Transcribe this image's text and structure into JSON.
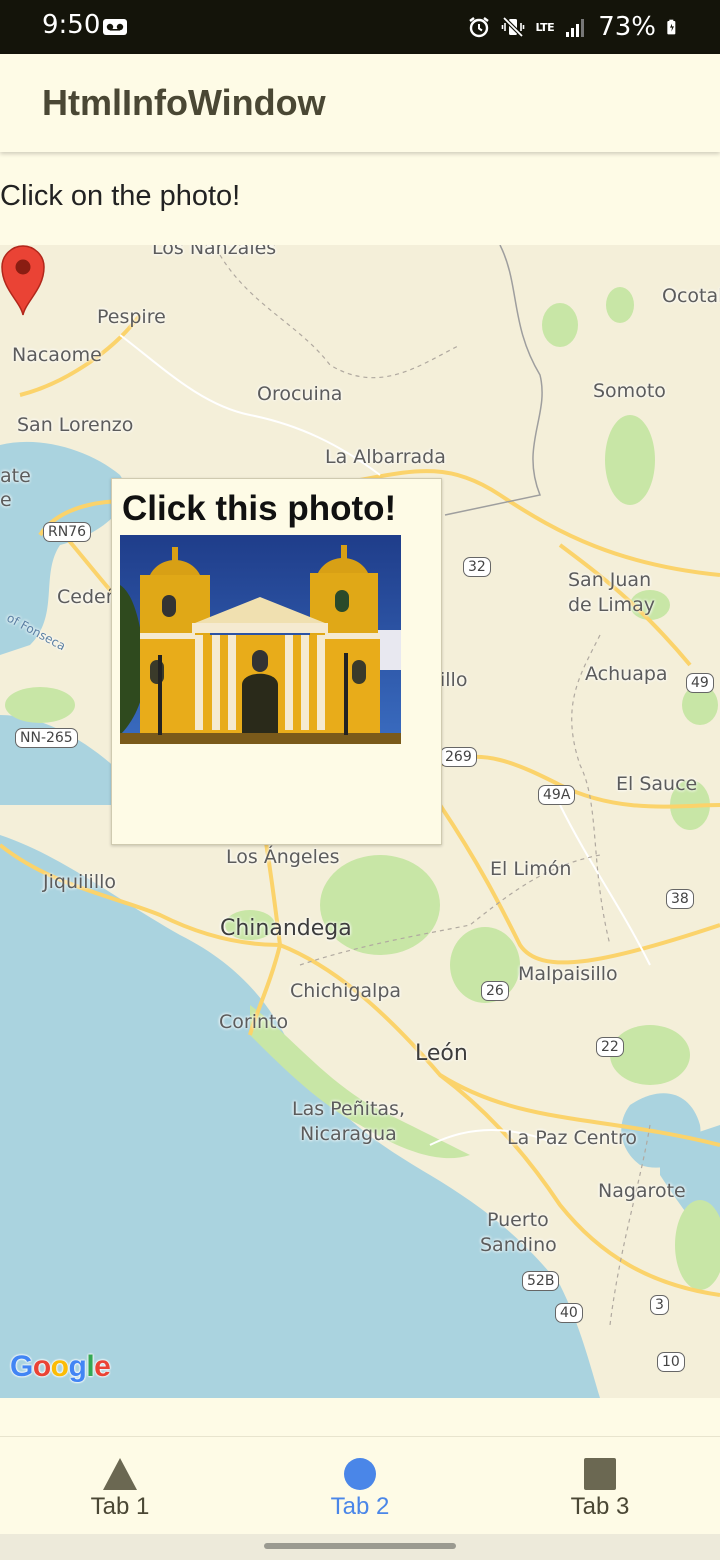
{
  "status_bar": {
    "time": "9:50",
    "network": "LTE",
    "battery": "73%",
    "icons": [
      "voicemail-icon",
      "alarm-icon",
      "vibrate-off-icon",
      "signal-icon",
      "battery-icon"
    ]
  },
  "app_bar": {
    "title": "HtmlInfoWindow"
  },
  "instruction": "Click on the photo!",
  "map": {
    "places": [
      "Los Nanzales",
      "Ocotal",
      "Pespire",
      "Nacaome",
      "Orocuina",
      "Somoto",
      "San Lorenzo",
      "La Albarrada",
      "ate",
      "e",
      "Cedeñ",
      "San Juan",
      "de Limay",
      "Achuapa",
      "illo",
      "El Sauce",
      "Los Ángeles",
      "El Limón",
      "Jiquilillo",
      "Chinandega",
      "Malpaisillo",
      "Chichigalpa",
      "Corinto",
      "León",
      "Las Peñitas,",
      "Nicaragua",
      "La Paz Centro",
      "Nagarote",
      "Puerto",
      "Sandino",
      "of Fonseca"
    ],
    "roads": [
      "RN76",
      "32",
      "49",
      "NN-265",
      "269",
      "49A",
      "38",
      "26",
      "22",
      "52B",
      "3",
      "40",
      "10"
    ],
    "attribution": "Google",
    "water_color": "#aad3df",
    "land_color": "#f4efd9",
    "park_color": "#c8e6a6",
    "highway_color": "#fbd36b"
  },
  "info_window": {
    "title": "Click this photo!",
    "photo": "cathedral-photo"
  },
  "marker": {
    "color": "#ea4335"
  },
  "bottom_nav": {
    "tabs": [
      {
        "label": "Tab 1",
        "icon": "triangle-icon",
        "active": false
      },
      {
        "label": "Tab 2",
        "icon": "circle-icon",
        "active": true
      },
      {
        "label": "Tab 3",
        "icon": "square-icon",
        "active": false
      }
    ],
    "active_color": "#4a86e8"
  }
}
